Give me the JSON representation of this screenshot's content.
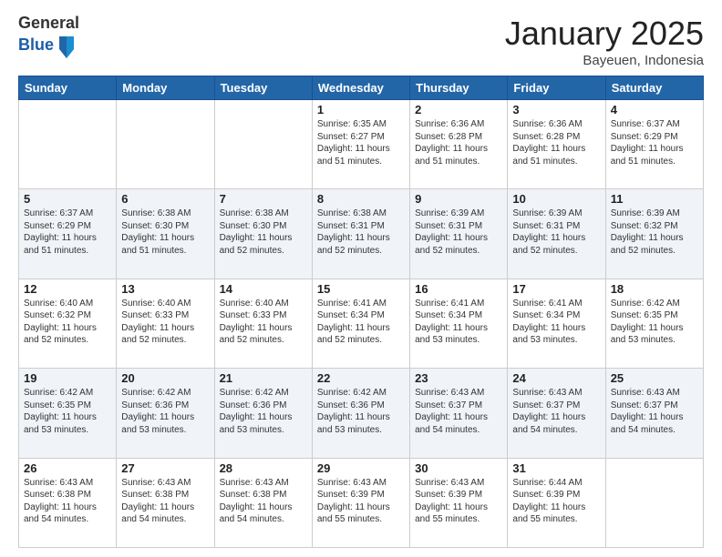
{
  "header": {
    "logo_general": "General",
    "logo_blue": "Blue",
    "month_title": "January 2025",
    "location": "Bayeuen, Indonesia"
  },
  "days_of_week": [
    "Sunday",
    "Monday",
    "Tuesday",
    "Wednesday",
    "Thursday",
    "Friday",
    "Saturday"
  ],
  "weeks": [
    [
      {
        "day": "",
        "info": ""
      },
      {
        "day": "",
        "info": ""
      },
      {
        "day": "",
        "info": ""
      },
      {
        "day": "1",
        "info": "Sunrise: 6:35 AM\nSunset: 6:27 PM\nDaylight: 11 hours and 51 minutes."
      },
      {
        "day": "2",
        "info": "Sunrise: 6:36 AM\nSunset: 6:28 PM\nDaylight: 11 hours and 51 minutes."
      },
      {
        "day": "3",
        "info": "Sunrise: 6:36 AM\nSunset: 6:28 PM\nDaylight: 11 hours and 51 minutes."
      },
      {
        "day": "4",
        "info": "Sunrise: 6:37 AM\nSunset: 6:29 PM\nDaylight: 11 hours and 51 minutes."
      }
    ],
    [
      {
        "day": "5",
        "info": "Sunrise: 6:37 AM\nSunset: 6:29 PM\nDaylight: 11 hours and 51 minutes."
      },
      {
        "day": "6",
        "info": "Sunrise: 6:38 AM\nSunset: 6:30 PM\nDaylight: 11 hours and 51 minutes."
      },
      {
        "day": "7",
        "info": "Sunrise: 6:38 AM\nSunset: 6:30 PM\nDaylight: 11 hours and 52 minutes."
      },
      {
        "day": "8",
        "info": "Sunrise: 6:38 AM\nSunset: 6:31 PM\nDaylight: 11 hours and 52 minutes."
      },
      {
        "day": "9",
        "info": "Sunrise: 6:39 AM\nSunset: 6:31 PM\nDaylight: 11 hours and 52 minutes."
      },
      {
        "day": "10",
        "info": "Sunrise: 6:39 AM\nSunset: 6:31 PM\nDaylight: 11 hours and 52 minutes."
      },
      {
        "day": "11",
        "info": "Sunrise: 6:39 AM\nSunset: 6:32 PM\nDaylight: 11 hours and 52 minutes."
      }
    ],
    [
      {
        "day": "12",
        "info": "Sunrise: 6:40 AM\nSunset: 6:32 PM\nDaylight: 11 hours and 52 minutes."
      },
      {
        "day": "13",
        "info": "Sunrise: 6:40 AM\nSunset: 6:33 PM\nDaylight: 11 hours and 52 minutes."
      },
      {
        "day": "14",
        "info": "Sunrise: 6:40 AM\nSunset: 6:33 PM\nDaylight: 11 hours and 52 minutes."
      },
      {
        "day": "15",
        "info": "Sunrise: 6:41 AM\nSunset: 6:34 PM\nDaylight: 11 hours and 52 minutes."
      },
      {
        "day": "16",
        "info": "Sunrise: 6:41 AM\nSunset: 6:34 PM\nDaylight: 11 hours and 53 minutes."
      },
      {
        "day": "17",
        "info": "Sunrise: 6:41 AM\nSunset: 6:34 PM\nDaylight: 11 hours and 53 minutes."
      },
      {
        "day": "18",
        "info": "Sunrise: 6:42 AM\nSunset: 6:35 PM\nDaylight: 11 hours and 53 minutes."
      }
    ],
    [
      {
        "day": "19",
        "info": "Sunrise: 6:42 AM\nSunset: 6:35 PM\nDaylight: 11 hours and 53 minutes."
      },
      {
        "day": "20",
        "info": "Sunrise: 6:42 AM\nSunset: 6:36 PM\nDaylight: 11 hours and 53 minutes."
      },
      {
        "day": "21",
        "info": "Sunrise: 6:42 AM\nSunset: 6:36 PM\nDaylight: 11 hours and 53 minutes."
      },
      {
        "day": "22",
        "info": "Sunrise: 6:42 AM\nSunset: 6:36 PM\nDaylight: 11 hours and 53 minutes."
      },
      {
        "day": "23",
        "info": "Sunrise: 6:43 AM\nSunset: 6:37 PM\nDaylight: 11 hours and 54 minutes."
      },
      {
        "day": "24",
        "info": "Sunrise: 6:43 AM\nSunset: 6:37 PM\nDaylight: 11 hours and 54 minutes."
      },
      {
        "day": "25",
        "info": "Sunrise: 6:43 AM\nSunset: 6:37 PM\nDaylight: 11 hours and 54 minutes."
      }
    ],
    [
      {
        "day": "26",
        "info": "Sunrise: 6:43 AM\nSunset: 6:38 PM\nDaylight: 11 hours and 54 minutes."
      },
      {
        "day": "27",
        "info": "Sunrise: 6:43 AM\nSunset: 6:38 PM\nDaylight: 11 hours and 54 minutes."
      },
      {
        "day": "28",
        "info": "Sunrise: 6:43 AM\nSunset: 6:38 PM\nDaylight: 11 hours and 54 minutes."
      },
      {
        "day": "29",
        "info": "Sunrise: 6:43 AM\nSunset: 6:39 PM\nDaylight: 11 hours and 55 minutes."
      },
      {
        "day": "30",
        "info": "Sunrise: 6:43 AM\nSunset: 6:39 PM\nDaylight: 11 hours and 55 minutes."
      },
      {
        "day": "31",
        "info": "Sunrise: 6:44 AM\nSunset: 6:39 PM\nDaylight: 11 hours and 55 minutes."
      },
      {
        "day": "",
        "info": ""
      }
    ]
  ]
}
